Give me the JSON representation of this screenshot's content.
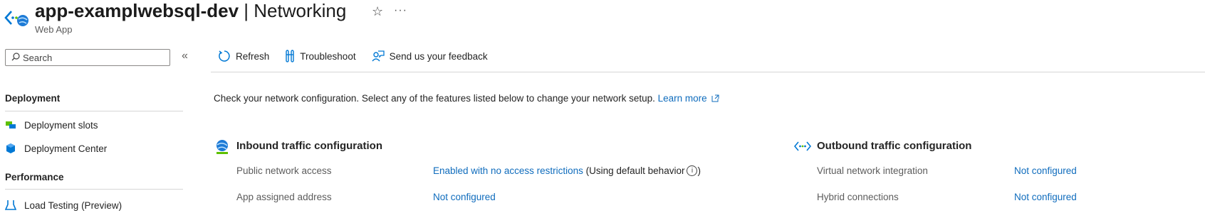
{
  "header": {
    "app_name": "app-examplwebsql-dev",
    "separator": " | ",
    "blade_title": "Networking",
    "subtitle": "Web App",
    "favorite_icon": "star-icon",
    "more_icon": "ellipsis-icon",
    "more_label": "···"
  },
  "sidebar": {
    "search": {
      "placeholder": "Search",
      "value": ""
    },
    "collapse_label": "«",
    "sections": [
      {
        "title": "Deployment",
        "items": [
          {
            "label": "Deployment slots",
            "icon": "deployment-slots-icon"
          },
          {
            "label": "Deployment Center",
            "icon": "deployment-center-icon"
          }
        ]
      },
      {
        "title": "Performance",
        "items": [
          {
            "label": "Load Testing (Preview)",
            "icon": "load-testing-icon"
          }
        ]
      }
    ]
  },
  "toolbar": {
    "refresh_label": "Refresh",
    "troubleshoot_label": "Troubleshoot",
    "feedback_label": "Send us your feedback"
  },
  "intro": {
    "text": "Check your network configuration. Select any of the features listed below to change your network setup.",
    "learn_more": "Learn more"
  },
  "inbound": {
    "title": "Inbound traffic configuration",
    "rows": [
      {
        "label": "Public network access",
        "value": "Enabled with no access restrictions",
        "suffix": "(Using default behavior",
        "suffix_end": ")"
      },
      {
        "label": "App assigned address",
        "value": "Not configured"
      }
    ]
  },
  "outbound": {
    "title": "Outbound traffic configuration",
    "rows": [
      {
        "label": "Virtual network integration",
        "value": "Not configured"
      },
      {
        "label": "Hybrid connections",
        "value": "Not configured"
      }
    ]
  },
  "colors": {
    "link": "#0f6cbd",
    "accent": "#0078d4"
  }
}
